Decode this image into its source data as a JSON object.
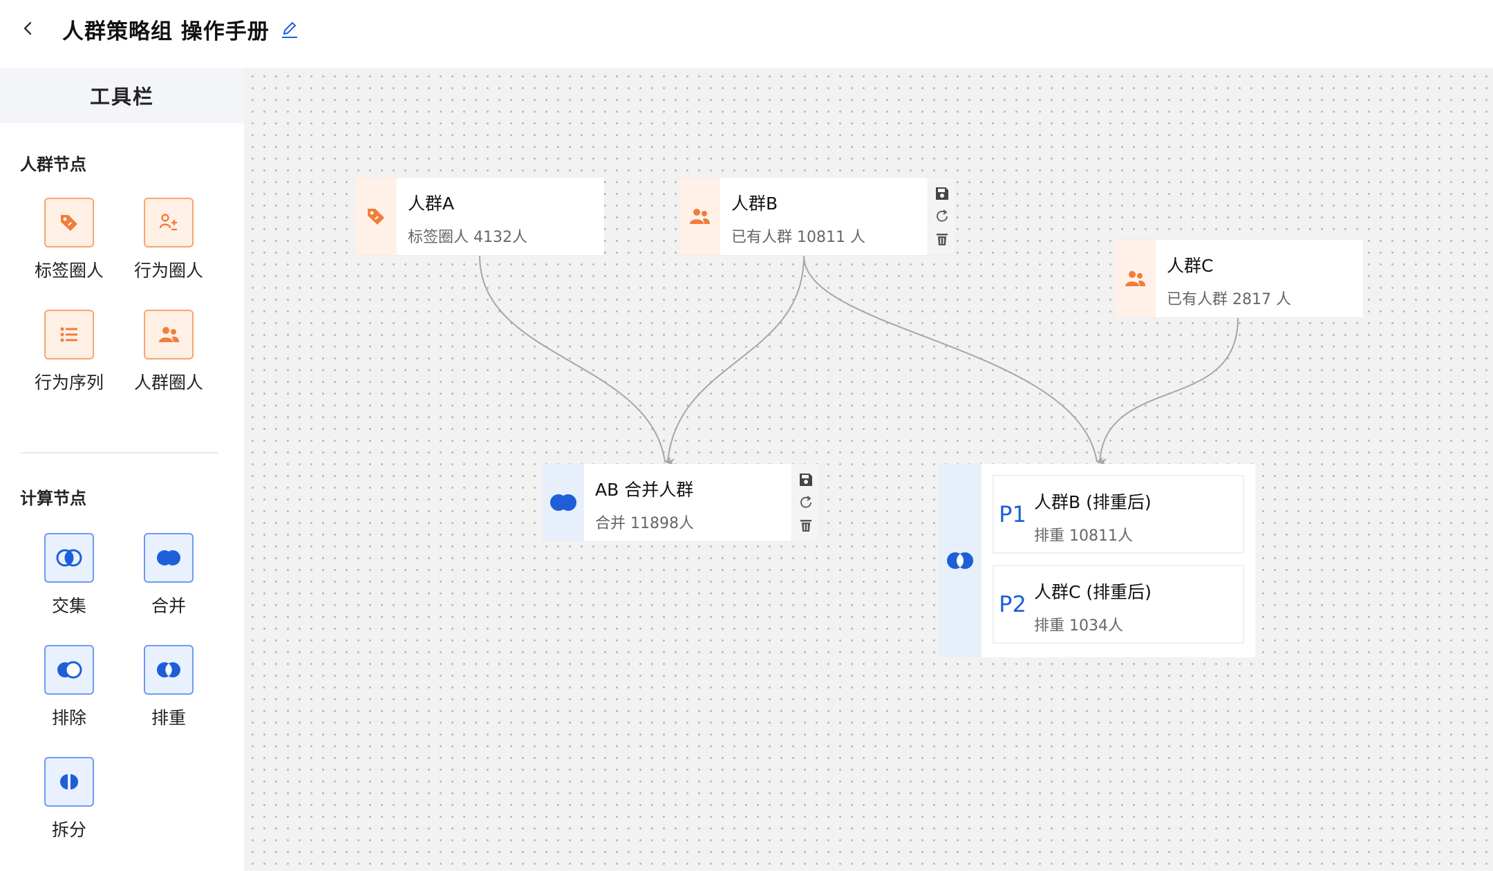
{
  "header": {
    "title": "人群策略组 操作手册"
  },
  "sidebar": {
    "title": "工具栏",
    "crowd_section": "人群节点",
    "crowd_tools": [
      {
        "label": "标签圈人",
        "icon": "tag-icon"
      },
      {
        "label": "行为圈人",
        "icon": "behavior-icon"
      },
      {
        "label": "行为序列",
        "icon": "list-icon"
      },
      {
        "label": "人群圈人",
        "icon": "users-icon"
      }
    ],
    "compute_section": "计算节点",
    "compute_tools": [
      {
        "label": "交集",
        "icon": "intersection-icon"
      },
      {
        "label": "合并",
        "icon": "union-icon"
      },
      {
        "label": "排除",
        "icon": "exclude-icon"
      },
      {
        "label": "排重",
        "icon": "dedup-icon"
      },
      {
        "label": "拆分",
        "icon": "split-icon"
      }
    ]
  },
  "nodes": {
    "a": {
      "title": "人群A",
      "sub": "标签圈人 4132人",
      "icon": "tag-icon"
    },
    "b": {
      "title": "人群B",
      "sub": "已有人群 10811 人",
      "icon": "users-icon"
    },
    "c": {
      "title": "人群C",
      "sub": "已有人群 2817 人",
      "icon": "users-icon"
    },
    "ab": {
      "title": "AB 合并人群",
      "sub": "合并 11898人",
      "icon": "union-icon"
    },
    "dedup": {
      "icon": "dedup-icon",
      "rows": [
        {
          "tag": "P1",
          "title": "人群B (排重后)",
          "sub": "排重 10811人"
        },
        {
          "tag": "P2",
          "title": "人群C (排重后)",
          "sub": "排重 1034人"
        }
      ]
    }
  },
  "colors": {
    "orange": "#f07d3c",
    "blue": "#1e5fd8",
    "edge": "#a6a6a6"
  }
}
